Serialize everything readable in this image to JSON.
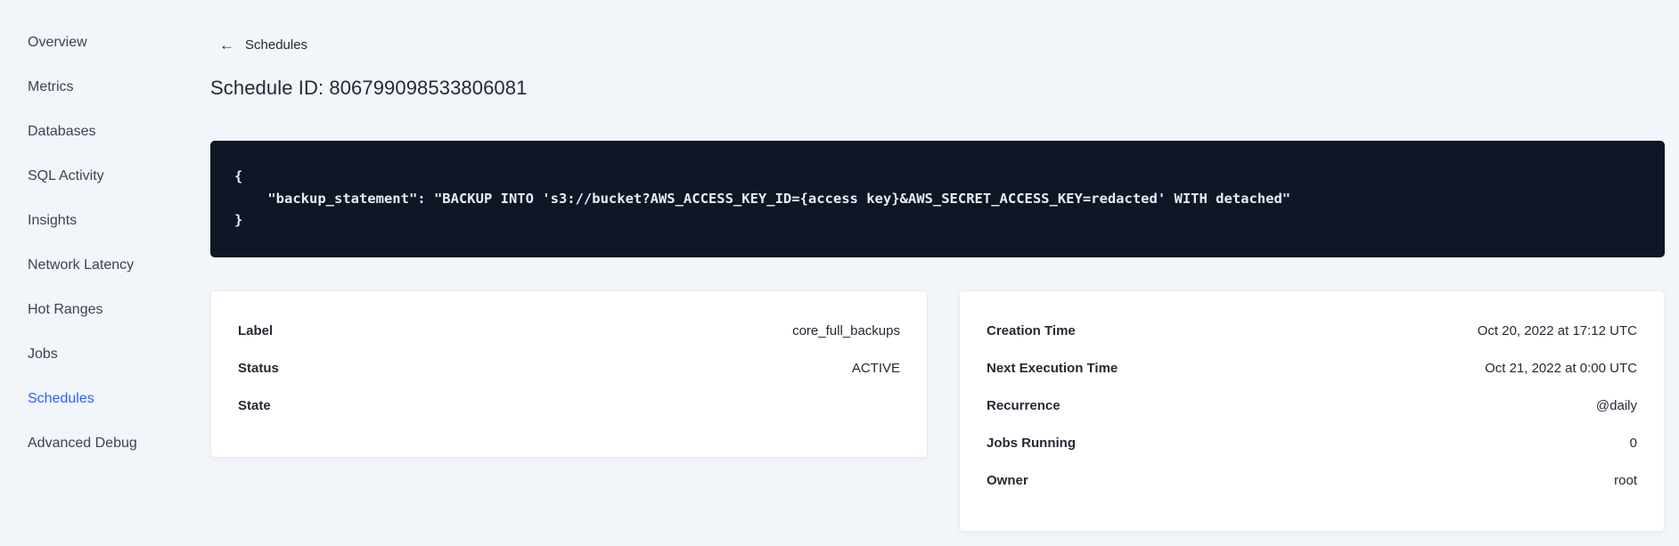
{
  "colors": {
    "background": "#f2f5f9",
    "accent": "#2962ff",
    "text": "#242a35",
    "sidebar_text": "#394455",
    "code_bg": "#0f1726",
    "code_text": "#e7ecf3"
  },
  "sidebar": {
    "items": [
      {
        "label": "Overview",
        "active": false
      },
      {
        "label": "Metrics",
        "active": false
      },
      {
        "label": "Databases",
        "active": false
      },
      {
        "label": "SQL Activity",
        "active": false
      },
      {
        "label": "Insights",
        "active": false
      },
      {
        "label": "Network Latency",
        "active": false
      },
      {
        "label": "Hot Ranges",
        "active": false
      },
      {
        "label": "Jobs",
        "active": false
      },
      {
        "label": "Schedules",
        "active": true
      },
      {
        "label": "Advanced Debug",
        "active": false
      }
    ]
  },
  "header": {
    "back_arrow": "←",
    "back_label": "Schedules",
    "title": "Schedule ID: 806799098533806081"
  },
  "code_block": {
    "lines": [
      "{",
      "    \"backup_statement\": \"BACKUP INTO 's3://bucket?AWS_ACCESS_KEY_ID={access key}&AWS_SECRET_ACCESS_KEY=redacted' WITH detached\"",
      "}"
    ]
  },
  "cards": {
    "left": {
      "rows": [
        {
          "label": "Label",
          "value": "core_full_backups"
        },
        {
          "label": "Status",
          "value": "ACTIVE"
        },
        {
          "label": "State",
          "value": ""
        }
      ]
    },
    "right": {
      "rows": [
        {
          "label": "Creation Time",
          "value": "Oct 20, 2022 at 17:12 UTC"
        },
        {
          "label": "Next Execution Time",
          "value": "Oct 21, 2022 at 0:00 UTC"
        },
        {
          "label": "Recurrence",
          "value": "@daily"
        },
        {
          "label": "Jobs Running",
          "value": "0"
        },
        {
          "label": "Owner",
          "value": "root"
        }
      ]
    }
  }
}
